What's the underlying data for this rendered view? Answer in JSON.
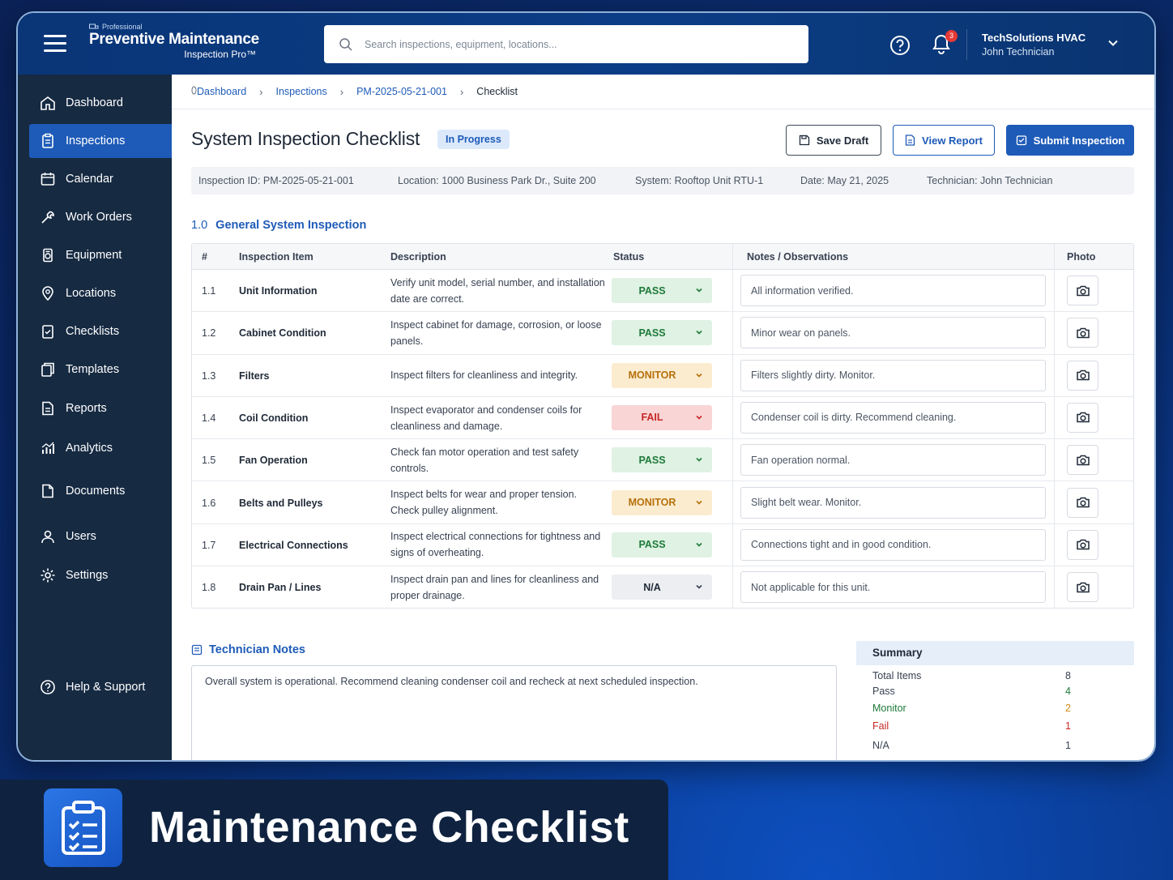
{
  "app": {
    "brand_pro": "Professional",
    "brand_title": "Preventive Maintenance",
    "brand_sub": "Inspection Pro™"
  },
  "search": {
    "placeholder": "Search inspections, equipment, locations..."
  },
  "notifications": {
    "count": "3"
  },
  "user": {
    "org": "TechSolutions HVAC",
    "name": "John Technician"
  },
  "sidebar": {
    "items": [
      {
        "label": "Dashboard",
        "icon": "home-icon"
      },
      {
        "label": "Inspections",
        "icon": "clipboard-icon",
        "active": true
      },
      {
        "label": "Calendar",
        "icon": "calendar-icon"
      },
      {
        "label": "Work Orders",
        "icon": "wrench-icon"
      },
      {
        "label": "Equipment",
        "icon": "equipment-icon"
      },
      {
        "label": "Locations",
        "icon": "location-pin-icon"
      },
      {
        "label": "Checklists",
        "icon": "checklist-icon"
      },
      {
        "label": "Templates",
        "icon": "templates-icon"
      },
      {
        "label": "Reports",
        "icon": "report-icon"
      },
      {
        "label": "Analytics",
        "icon": "analytics-icon"
      },
      {
        "label": "Documents",
        "icon": "document-icon"
      },
      {
        "label": "Users",
        "icon": "user-icon"
      },
      {
        "label": "Settings",
        "icon": "gear-icon"
      }
    ],
    "help": "Help & Support"
  },
  "breadcrumb": {
    "dashboard": "Dashboard",
    "inspections": "Inspections",
    "id": "PM-2025-05-21-001",
    "current": "Checklist"
  },
  "page": {
    "title": "System Inspection Checklist",
    "status": "In Progress",
    "save_label": "Save Draft",
    "view_label": "View Report",
    "submit_label": "Submit Inspection"
  },
  "info": {
    "inspection_id": "Inspection ID:  PM-2025-05-21-001",
    "location": "Location:  1000 Business Park Dr., Suite 200",
    "system": "System:  Rooftop Unit RTU-1",
    "date": "Date:  May 21, 2025",
    "technician": "Technician:  John Technician"
  },
  "section": {
    "number": "1.0",
    "title": "General System Inspection"
  },
  "table": {
    "headers": {
      "num": "#",
      "item": "Inspection Item",
      "desc": "Description",
      "status": "Status",
      "notes": "Notes / Observations",
      "photo": "Photo"
    },
    "rows": [
      {
        "num": "1.1",
        "item": "Unit Information",
        "desc": "Verify unit model, serial number, and installation date are correct.",
        "status": "PASS",
        "note": "All information verified."
      },
      {
        "num": "1.2",
        "item": "Cabinet Condition",
        "desc": "Inspect cabinet for damage, corrosion, or loose panels.",
        "status": "PASS",
        "note": "Minor wear on panels."
      },
      {
        "num": "1.3",
        "item": "Filters",
        "desc": "Inspect filters for cleanliness and integrity.",
        "status": "MONITOR",
        "note": "Filters slightly dirty. Monitor."
      },
      {
        "num": "1.4",
        "item": "Coil Condition",
        "desc": "Inspect evaporator and condenser coils for cleanliness and damage.",
        "status": "FAIL",
        "note": "Condenser coil is dirty. Recommend cleaning."
      },
      {
        "num": "1.5",
        "item": "Fan Operation",
        "desc": "Check fan motor operation and test safety controls.",
        "status": "PASS",
        "note": "Fan operation normal."
      },
      {
        "num": "1.6",
        "item": "Belts and Pulleys",
        "desc": "Inspect belts for wear and proper tension. Check pulley alignment.",
        "status": "MONITOR",
        "note": "Slight belt wear. Monitor."
      },
      {
        "num": "1.7",
        "item": "Electrical Connections",
        "desc": "Inspect electrical connections for tightness and signs of overheating.",
        "status": "PASS",
        "note": "Connections tight and in good condition."
      },
      {
        "num": "1.8",
        "item": "Drain Pan / Lines",
        "desc": "Inspect drain pan and lines for cleanliness and proper drainage.",
        "status": "N/A",
        "note": "Not applicable for this unit."
      }
    ]
  },
  "tech_notes": {
    "title": "Technician Notes",
    "text": "Overall system is operational. Recommend cleaning condenser coil and recheck at next scheduled inspection."
  },
  "summary": {
    "title": "Summary",
    "rows": [
      {
        "label": "Total Items",
        "value": "8",
        "color": "#374151",
        "value_color": "#374151"
      },
      {
        "label": "Pass",
        "value": "4",
        "color": "#374151",
        "value_color": "#1f7a3a"
      },
      {
        "label": "Monitor",
        "value": "2",
        "color": "#1f7a3a",
        "value_color": "#d08a12"
      },
      {
        "label": "Fail",
        "value": "1",
        "color": "#c62828",
        "value_color": "#c62828"
      },
      {
        "label": "N/A",
        "value": "1",
        "color": "#374151",
        "value_color": "#374151"
      }
    ]
  },
  "banner": {
    "title": "Maintenance Checklist",
    "icon": "clipboard-checklist-icon"
  },
  "colors": {
    "primary": "#1e5bb8",
    "sidebar": "#162a42",
    "pass": "#1f7a3a",
    "monitor": "#b7700b",
    "fail": "#c62828"
  }
}
